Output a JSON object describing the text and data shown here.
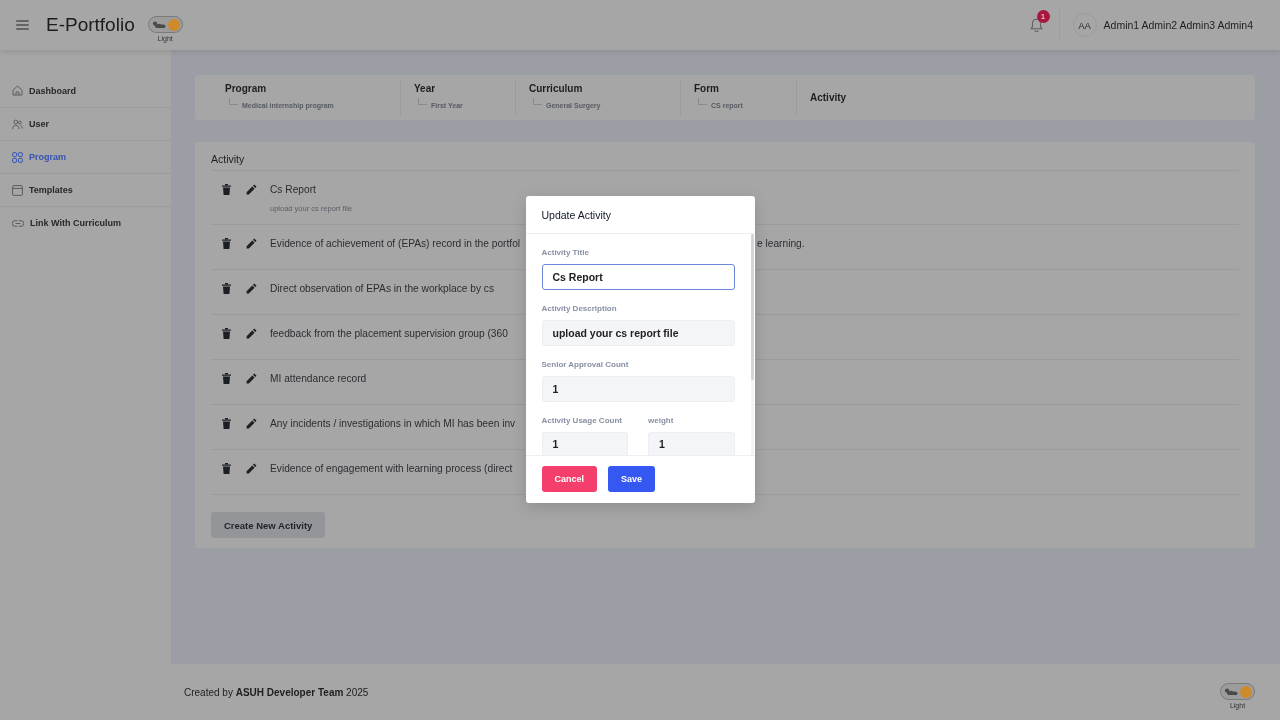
{
  "header": {
    "title": "E-Portfolio",
    "theme_toggle": {
      "label": "Light",
      "light": true
    },
    "notifications": {
      "count": "1"
    },
    "user": {
      "initials": "AA",
      "name": "Admin1 Admin2 Admin3 Admin4"
    }
  },
  "sidebar": {
    "items": [
      {
        "label": "Dashboard",
        "selected": false
      },
      {
        "label": "User",
        "selected": false
      },
      {
        "label": "Program",
        "selected": true
      },
      {
        "label": "Templates",
        "selected": false
      },
      {
        "label": "Link With Curriculum",
        "selected": false
      }
    ]
  },
  "breadcrumb": {
    "steps": [
      {
        "title": "Program",
        "value": "Medical internship program"
      },
      {
        "title": "Year",
        "value": "First Year"
      },
      {
        "title": "Curriculum",
        "value": "General Surgery"
      },
      {
        "title": "Form",
        "value": "CS report"
      },
      {
        "title": "Activity"
      }
    ]
  },
  "activities": {
    "heading": "Activity",
    "rows": [
      {
        "title": "Cs Report",
        "description": "upload your cs report file"
      },
      {
        "title": "Evidence of achievement of (EPAs) record in the portfol",
        "title_tail": "e learning."
      },
      {
        "title": "Direct observation of EPAs in the workplace by cs"
      },
      {
        "title": "feedback from the placement supervision group (360"
      },
      {
        "title": "MI attendance record"
      },
      {
        "title": "Any incidents / investigations in which MI has been inv"
      },
      {
        "title": "Evidence of engagement with learning process (direct"
      }
    ],
    "create_button": "Create New Activity"
  },
  "dialog": {
    "title": "Update Activity",
    "rows": [
      {
        "fields": [
          {
            "label": "Activity Title",
            "value": "Cs Report",
            "focused": true
          }
        ]
      },
      {
        "fields": [
          {
            "label": "Activity Description",
            "value": "upload your cs report file",
            "focused": false
          }
        ]
      },
      {
        "fields": [
          {
            "label": "Senior Approval Count",
            "value": "1",
            "focused": false
          }
        ]
      },
      {
        "fields": [
          {
            "label": "Activity Usage Count",
            "value": "1",
            "focused": false
          },
          {
            "label": "weight",
            "value": "1",
            "focused": false
          }
        ]
      }
    ],
    "buttons": [
      {
        "label": "Cancel",
        "kind": "danger"
      },
      {
        "label": "Save",
        "kind": "primary"
      }
    ]
  },
  "footer": {
    "credit": "Created by **ASUH Developer Team** 2025",
    "theme_toggle": {
      "label": "Light",
      "light": true
    }
  }
}
